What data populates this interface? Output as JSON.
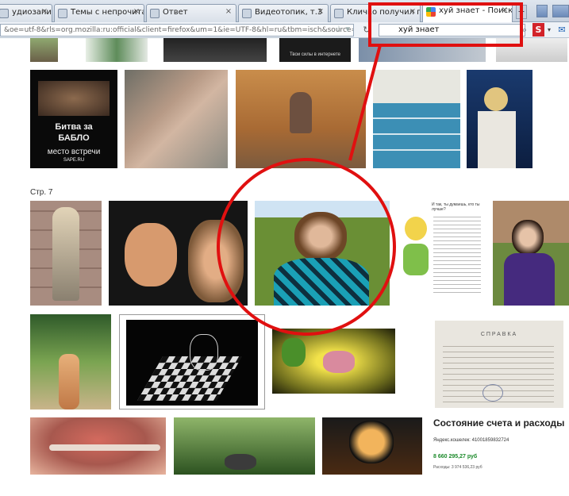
{
  "browser": {
    "tabs": [
      {
        "title": "удиозапис...",
        "active": false
      },
      {
        "title": "Темы с непрочитан...",
        "active": false
      },
      {
        "title": "Ответ",
        "active": false
      },
      {
        "title": "Видеотопик, т.3",
        "active": false
      },
      {
        "title": "Кличко получил по...",
        "active": false
      },
      {
        "title": "хуй знает - Поиск ...",
        "active": true
      }
    ],
    "tab_close_glyph": "×",
    "new_tab_glyph": "+",
    "url": "&oe=utf-8&rls=org.mozilla:ru:official&client=firefox&um=1&ie=UTF-8&hl=ru&tbm=isch&source=og&sa=N&tab=",
    "search_query": "хуй знает"
  },
  "results": {
    "page_label": "Стр. 7",
    "tiles": [
      {
        "name": "poster-battle-for-money",
        "line1": "Битва за",
        "line2": "БАБЛО",
        "line3": "место встречи",
        "line4": "SAPE.RU"
      },
      {
        "name": "top-partial-slogan",
        "text": "Твои силы в интернете"
      },
      {
        "name": "comic-text",
        "text": "И так, ты думаешь, кто ты лучше?"
      },
      {
        "name": "certificate",
        "title": "СПРАВКА"
      },
      {
        "name": "account-screenshot",
        "heading": "Состояние счета и расходы",
        "wallet": "Яндекс.кошелек: 41001859832724",
        "amount": "8 660 295,27 руб",
        "expenses": "Расходы: 3 974 536,23 руб"
      }
    ]
  },
  "annotation_color": "#e01010"
}
